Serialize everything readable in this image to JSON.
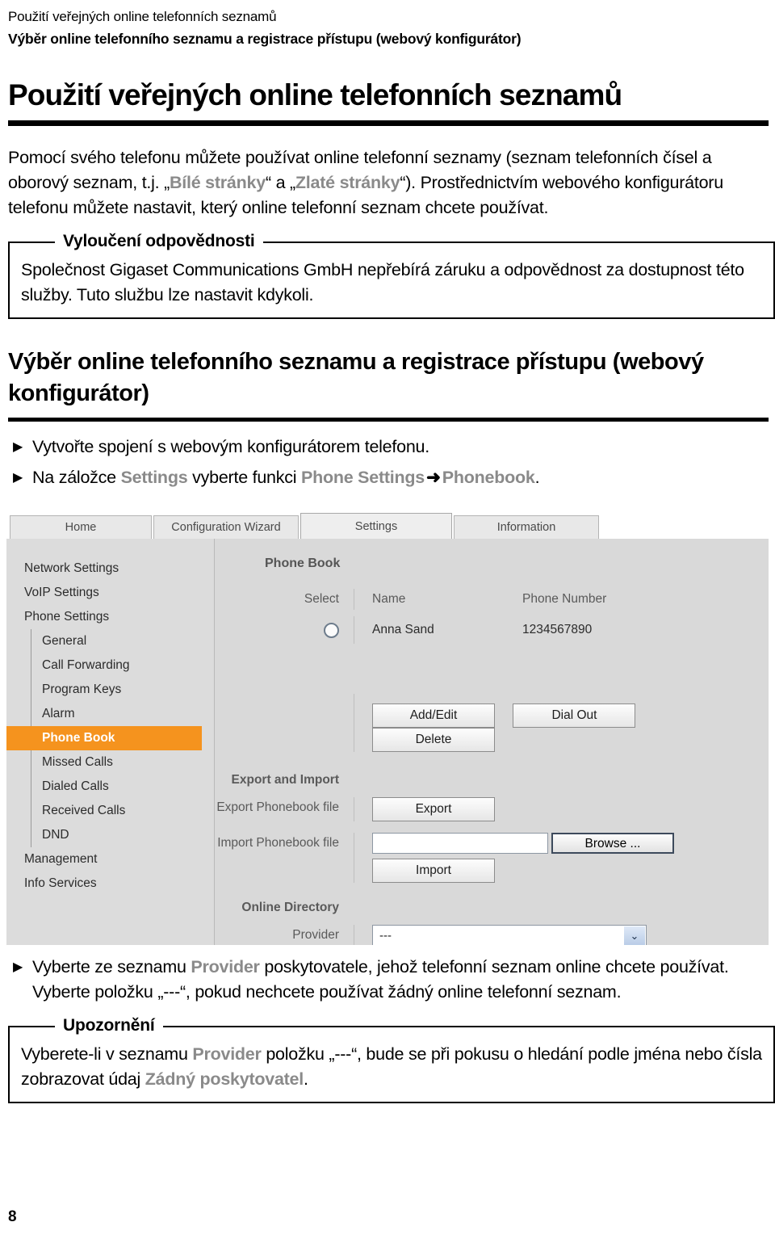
{
  "running_head": {
    "line1": "Použití veřejných online telefonních seznamů",
    "line2": "Výběr online telefonního seznamu a registrace přístupu (webový konfigurátor)"
  },
  "chapter": {
    "title": "Použití veřejných online telefonních seznamů"
  },
  "intro": {
    "part1": "Pomocí svého telefonu můžete používat online telefonní seznamy (seznam telefonních čísel a oborový seznam, t.j. „",
    "term_white": "Bílé stránky",
    "part2": "“ a „",
    "term_yellow": "Zlaté stránky",
    "part3": "“). Prostřednictvím webového konfigurátoru telefonu můžete nastavit, který online telefonní seznam chcete používat."
  },
  "disclaimer": {
    "legend": "Vyloučení odpovědnosti",
    "body": "Společnost Gigaset Communications GmbH nepřebírá záruku a odpovědnost za dostupnost této služby. Tuto službu lze nastavit kdykoli."
  },
  "section": {
    "title": "Výběr online telefonního seznamu a registrace přístupu (webový konfigurátor)"
  },
  "steps": {
    "bullet_glyph": "▶",
    "step1": "Vytvořte spojení s webovým konfigurátorem telefonu.",
    "step2_a": "Na záložce ",
    "step2_term1": "Settings",
    "step2_b": " vyberte funkci ",
    "step2_term2": "Phone Settings",
    "step2_arrow": "➜",
    "step2_term3": "Phonebook",
    "step2_c": "."
  },
  "screenshot": {
    "tabs": [
      {
        "label": "Home",
        "active": false
      },
      {
        "label": "Configuration Wizard",
        "active": false
      },
      {
        "label": "Settings",
        "active": true
      },
      {
        "label": "Information",
        "active": false
      }
    ],
    "menu": [
      {
        "label": "Network Settings",
        "level": 0,
        "active": false
      },
      {
        "label": "VoIP Settings",
        "level": 0,
        "active": false
      },
      {
        "label": "Phone Settings",
        "level": 0,
        "active": false
      },
      {
        "label": "General",
        "level": 1,
        "active": false
      },
      {
        "label": "Call Forwarding",
        "level": 1,
        "active": false
      },
      {
        "label": "Program Keys",
        "level": 1,
        "active": false
      },
      {
        "label": "Alarm",
        "level": 1,
        "active": false
      },
      {
        "label": "Phone Book",
        "level": 1,
        "active": true
      },
      {
        "label": "Missed Calls",
        "level": 1,
        "active": false
      },
      {
        "label": "Dialed Calls",
        "level": 1,
        "active": false
      },
      {
        "label": "Received Calls",
        "level": 1,
        "active": false
      },
      {
        "label": "DND",
        "level": 1,
        "active": false
      },
      {
        "label": "Management",
        "level": 0,
        "active": false
      },
      {
        "label": "Info Services",
        "level": 0,
        "active": false
      }
    ],
    "phonebook": {
      "pane_title": "Phone Book",
      "col_select": "Select",
      "col_name": "Name",
      "col_number": "Phone Number",
      "rows": [
        {
          "name": "Anna Sand",
          "number": "1234567890"
        }
      ],
      "btn_add_edit": "Add/Edit",
      "btn_dial_out": "Dial Out",
      "btn_delete": "Delete"
    },
    "export_import": {
      "heading": "Export and Import",
      "label_export": "Export Phonebook file",
      "btn_export": "Export",
      "label_import": "Import Phonebook file",
      "import_value": "",
      "btn_browse": "Browse ...",
      "btn_import": "Import"
    },
    "online_directory": {
      "heading": "Online Directory",
      "label_provider": "Provider",
      "provider_value": "---",
      "chevron": "⌄"
    },
    "colors": {
      "active_menu": "#f5931e",
      "pane_bg": "#d9d9d9",
      "sidebar_bg": "#dcdcdc"
    }
  },
  "lower_steps": {
    "s1_a": "Vyberte ze seznamu ",
    "s1_term": "Provider",
    "s1_b": " poskytovatele, jehož telefonní seznam online chcete používat. Vyberte položku „---“, pokud nechcete používat žádný online telefonní seznam."
  },
  "note": {
    "legend": "Upozornění",
    "body_a": "Vyberete-li v seznamu ",
    "term1": "Provider",
    "body_b": " položku „---“, bude se při pokusu o hledání podle jména nebo čísla zobrazovat údaj ",
    "term2": "Zádný poskytovatel",
    "body_c": "."
  },
  "footer": {
    "page_number": "8"
  }
}
